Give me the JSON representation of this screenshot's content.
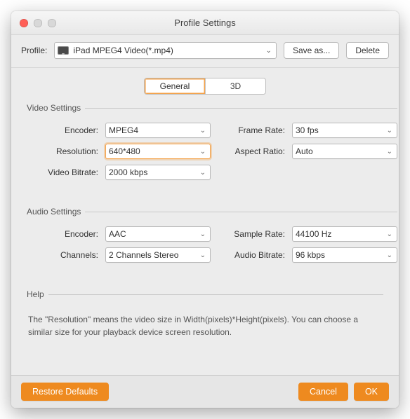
{
  "window": {
    "title": "Profile Settings"
  },
  "top": {
    "profile_label": "Profile:",
    "profile_value": "iPad MPEG4 Video(*.mp4)",
    "save_as_label": "Save as...",
    "delete_label": "Delete"
  },
  "tabs": {
    "general": "General",
    "threeD": "3D"
  },
  "video": {
    "legend": "Video Settings",
    "encoder_label": "Encoder:",
    "encoder_value": "MPEG4",
    "framerate_label": "Frame Rate:",
    "framerate_value": "30 fps",
    "resolution_label": "Resolution:",
    "resolution_value": "640*480",
    "aspect_label": "Aspect Ratio:",
    "aspect_value": "Auto",
    "bitrate_label": "Video Bitrate:",
    "bitrate_value": "2000 kbps"
  },
  "audio": {
    "legend": "Audio Settings",
    "encoder_label": "Encoder:",
    "encoder_value": "AAC",
    "samplerate_label": "Sample Rate:",
    "samplerate_value": "44100 Hz",
    "channels_label": "Channels:",
    "channels_value": "2 Channels Stereo",
    "abitrate_label": "Audio Bitrate:",
    "abitrate_value": "96 kbps"
  },
  "help": {
    "legend": "Help",
    "text": "The \"Resolution\" means the video size in Width(pixels)*Height(pixels).  You can choose a similar size for your playback device screen resolution."
  },
  "footer": {
    "restore": "Restore Defaults",
    "cancel": "Cancel",
    "ok": "OK"
  }
}
